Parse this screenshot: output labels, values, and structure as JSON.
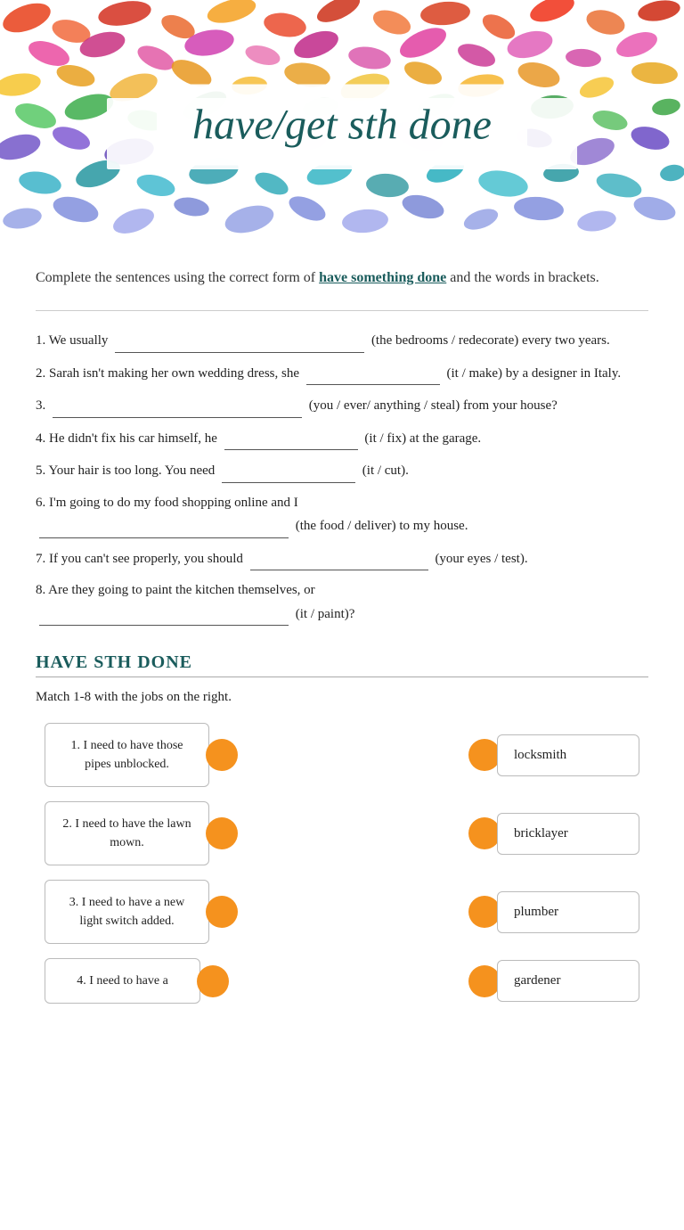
{
  "header": {
    "title": "have/get sth done"
  },
  "instruction": {
    "prefix": "Complete the sentences using the correct form of ",
    "highlight": "have something done",
    "suffix": " and the words in brackets."
  },
  "exercises": [
    {
      "number": "1.",
      "prefix": "We usually",
      "blank_size": "large",
      "suffix": "(the bedrooms / redecorate) every two years."
    },
    {
      "number": "2.",
      "prefix": "Sarah isn't making her own wedding dress, she",
      "blank_size": "medium",
      "suffix": "(it / make) by a designer in Italy."
    },
    {
      "number": "3.",
      "prefix": "",
      "blank_size": "large",
      "suffix": "(you / ever/ anything / steal) from your house?"
    },
    {
      "number": "4.",
      "prefix": "He didn't fix his car himself, he",
      "blank_size": "small",
      "suffix": "(it / fix) at the garage."
    },
    {
      "number": "5.",
      "prefix": "Your hair is too long. You need",
      "blank_size": "small",
      "suffix": "(it / cut)."
    },
    {
      "number": "6.",
      "prefix": "I'm going to do my food shopping online and I",
      "blank_size": "large",
      "suffix": "(the food / deliver) to my house."
    },
    {
      "number": "7.",
      "prefix": "If you can't see properly, you should",
      "blank_size": "medium",
      "suffix": "(your eyes / test)."
    },
    {
      "number": "8.",
      "prefix": "Are they going to paint the kitchen themselves, or",
      "blank_size": "large",
      "suffix": "(it / paint)?"
    }
  ],
  "section2": {
    "title": "HAVE STH DONE",
    "instruction": "Match 1-8 with the jobs on the right.",
    "left_items": [
      "1. I need to have those pipes unblocked.",
      "2. I need to have the lawn mown.",
      "3. I need to have a new light switch added.",
      "4. I need to have a"
    ],
    "right_items": [
      "locksmith",
      "bricklayer",
      "plumber",
      "gardener"
    ]
  }
}
